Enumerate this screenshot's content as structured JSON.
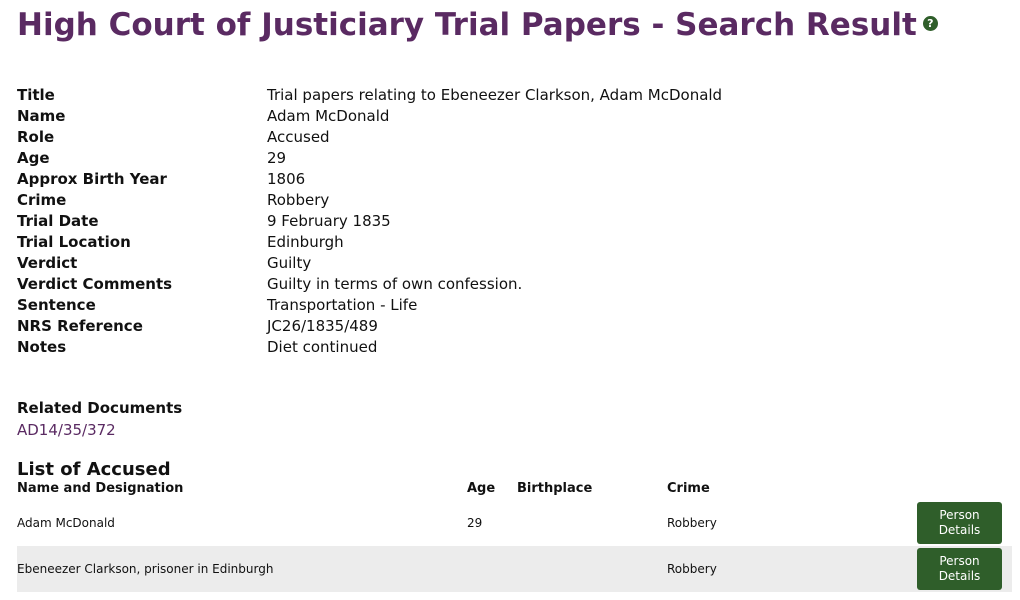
{
  "header": {
    "title": "High Court of Justiciary Trial Papers - Search Result",
    "help_glyph": "?"
  },
  "details": [
    {
      "label": "Title",
      "value": "Trial papers relating to Ebeneezer Clarkson, Adam McDonald"
    },
    {
      "label": "Name",
      "value": "Adam McDonald"
    },
    {
      "label": "Role",
      "value": "Accused"
    },
    {
      "label": "Age",
      "value": "29"
    },
    {
      "label": "Approx Birth Year",
      "value": "1806"
    },
    {
      "label": "Crime",
      "value": "Robbery"
    },
    {
      "label": "Trial Date",
      "value": "9 February 1835"
    },
    {
      "label": "Trial Location",
      "value": "Edinburgh"
    },
    {
      "label": "Verdict",
      "value": "Guilty"
    },
    {
      "label": "Verdict Comments",
      "value": "Guilty in terms of own confession."
    },
    {
      "label": "Sentence",
      "value": "Transportation - Life"
    },
    {
      "label": "NRS Reference",
      "value": "JC26/1835/489"
    },
    {
      "label": "Notes",
      "value": "Diet continued"
    }
  ],
  "related": {
    "title": "Related Documents",
    "link": "AD14/35/372"
  },
  "accused": {
    "title": "List of Accused",
    "columns": {
      "name": "Name and Designation",
      "age": "Age",
      "birthplace": "Birthplace",
      "crime": "Crime"
    },
    "rows": [
      {
        "name": "Adam McDonald",
        "age": "29",
        "birthplace": "",
        "crime": "Robbery",
        "button": "Person Details"
      },
      {
        "name": "Ebeneezer Clarkson, prisoner in Edinburgh",
        "age": "",
        "birthplace": "",
        "crime": "Robbery",
        "button": "Person Details"
      }
    ]
  },
  "colors": {
    "heading": "#5a2a62",
    "button": "#2f5e2a",
    "row_alt": "#ececec"
  }
}
